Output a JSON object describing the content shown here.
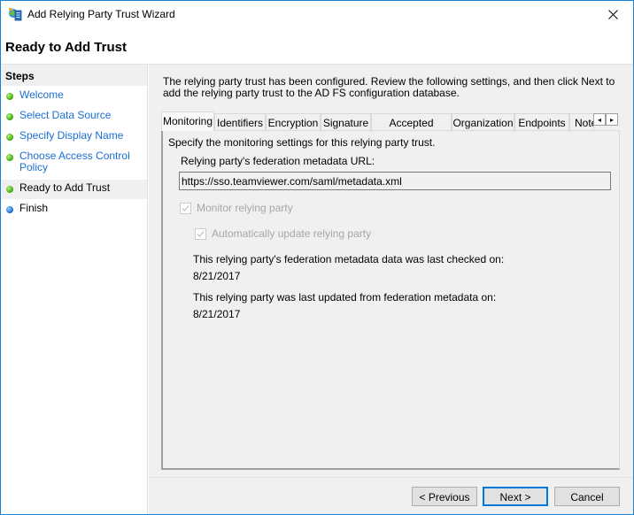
{
  "window": {
    "title": "Add Relying Party Trust Wizard",
    "app_icon": "adfs-wizard-icon",
    "close_icon": "close-icon"
  },
  "header": {
    "title": "Ready to Add Trust"
  },
  "sidebar": {
    "heading": "Steps",
    "items": [
      {
        "label": "Welcome",
        "status": "completed",
        "color": "#3aa70b"
      },
      {
        "label": "Select Data Source",
        "status": "completed",
        "color": "#3aa70b"
      },
      {
        "label": "Specify Display Name",
        "status": "completed",
        "color": "#3aa70b"
      },
      {
        "label": "Choose Access Control Policy",
        "status": "completed",
        "color": "#3aa70b"
      },
      {
        "label": "Ready to Add Trust",
        "status": "current",
        "color": "#3aa70b"
      },
      {
        "label": "Finish",
        "status": "pending",
        "color": "#1167d8"
      }
    ]
  },
  "main": {
    "intro": "The relying party trust has been configured. Review the following settings, and then click Next to add the relying party trust to the AD FS configuration database.",
    "tabs": [
      {
        "label": "Monitoring",
        "active": true
      },
      {
        "label": "Identifiers",
        "active": false
      },
      {
        "label": "Encryption",
        "active": false
      },
      {
        "label": "Signature",
        "active": false
      },
      {
        "label": "Accepted Claims",
        "active": false
      },
      {
        "label": "Organization",
        "active": false
      },
      {
        "label": "Endpoints",
        "active": false
      },
      {
        "label": "Note",
        "active": false
      }
    ],
    "tab_scroll_left": "◂",
    "tab_scroll_right": "▸",
    "monitoring": {
      "description": "Specify the monitoring settings for this relying party trust.",
      "url_label": "Relying party's federation metadata URL:",
      "url_value": "https://sso.teamviewer.com/saml/metadata.xml",
      "monitor_checkbox": {
        "label": "Monitor relying party",
        "checked": true,
        "enabled": false
      },
      "auto_update_checkbox": {
        "label": "Automatically update relying party",
        "checked": true,
        "enabled": false
      },
      "last_checked_label": "This relying party's federation metadata data was last checked on:",
      "last_checked_value": "8/21/2017",
      "last_updated_label": "This relying party was last updated from federation metadata on:",
      "last_updated_value": "8/21/2017"
    }
  },
  "footer": {
    "previous_label": "< Previous",
    "next_label": "Next >",
    "cancel_label": "Cancel"
  },
  "colors": {
    "accent": "#0078d7",
    "window_border": "#1883d7",
    "link": "#1a6fd4"
  }
}
